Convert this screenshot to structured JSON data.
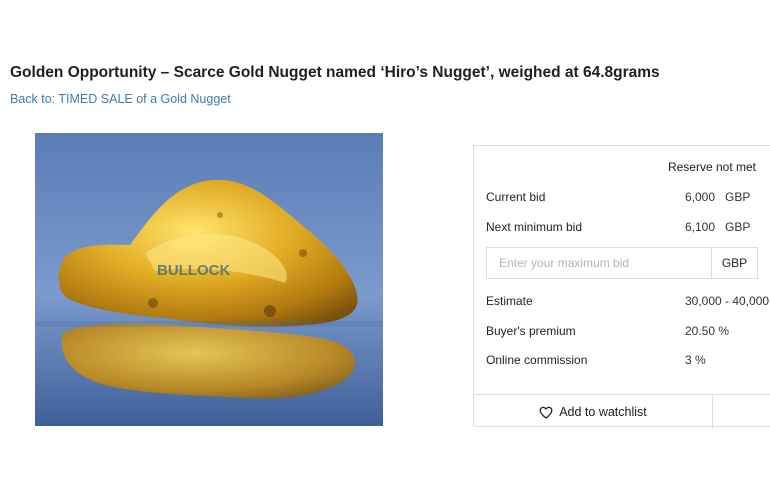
{
  "lot": {
    "title": "Golden Opportunity – Scarce Gold Nugget named ‘Hiro’s Nugget’, weighed at 64.8grams",
    "back_link": "Back to: TIMED SALE of a Gold Nugget",
    "watermark": "BULLOCK"
  },
  "bidding": {
    "reserve_status": "Reserve not met",
    "current_bid_label": "Current bid",
    "current_bid_value": "6,000",
    "current_bid_currency": "GBP",
    "next_min_label": "Next minimum bid",
    "next_min_value": "6,100",
    "next_min_currency": "GBP",
    "max_bid_placeholder": "Enter your maximum bid",
    "max_bid_value": "",
    "input_currency": "GBP",
    "estimate_label": "Estimate",
    "estimate_value": "30,000 - 40,000",
    "premium_label": "Buyer's premium",
    "premium_value": "20.50 %",
    "commission_label": "Online commission",
    "commission_value": "3 %",
    "watchlist_label": "Add to watchlist",
    "watchlist_icon": "heart-outline-icon"
  },
  "colors": {
    "link": "#3f7ab3",
    "photo_background": "#6a8bc2",
    "gold": "#d9a520"
  }
}
